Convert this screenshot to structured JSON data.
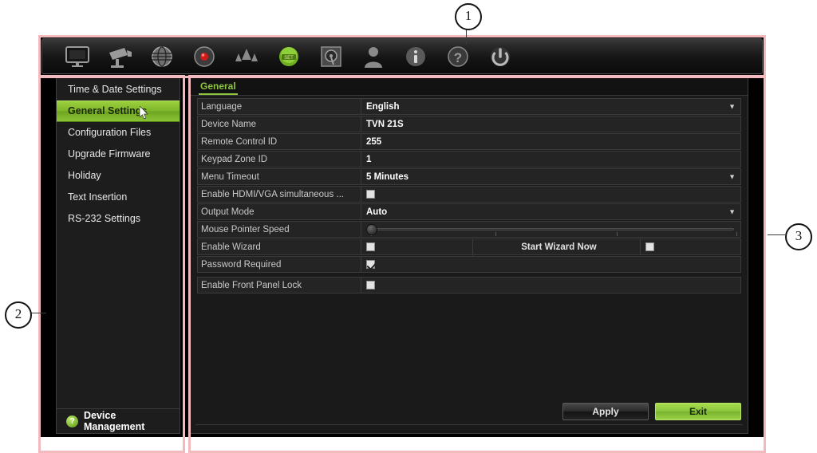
{
  "toolbar": {
    "items": [
      {
        "name": "display-monitor-icon",
        "label": "Display"
      },
      {
        "name": "camera-icon",
        "label": "Camera"
      },
      {
        "name": "network-globe-icon",
        "label": "Network"
      },
      {
        "name": "record-icon",
        "label": "Recording"
      },
      {
        "name": "alarm-icon",
        "label": "Alarm"
      },
      {
        "name": "device-settings-icon",
        "label": "Device Settings"
      },
      {
        "name": "hard-disk-icon",
        "label": "Storage"
      },
      {
        "name": "user-icon",
        "label": "User Management"
      },
      {
        "name": "info-icon",
        "label": "System Information"
      },
      {
        "name": "help-icon",
        "label": "Help"
      },
      {
        "name": "power-icon",
        "label": "Shutdown"
      }
    ]
  },
  "sidebar": {
    "items": [
      {
        "label": "Time & Date Settings",
        "selected": false
      },
      {
        "label": "General Settings",
        "selected": true
      },
      {
        "label": "Configuration Files",
        "selected": false
      },
      {
        "label": "Upgrade Firmware",
        "selected": false
      },
      {
        "label": "Holiday",
        "selected": false
      },
      {
        "label": "Text Insertion",
        "selected": false
      },
      {
        "label": "RS-232 Settings",
        "selected": false
      }
    ],
    "footer": {
      "icon_glyph": "?",
      "label": "Device Management"
    }
  },
  "content": {
    "tab": "General",
    "rows": {
      "language": {
        "label": "Language",
        "value": "English"
      },
      "device_name": {
        "label": "Device Name",
        "value": "TVN 21S"
      },
      "remote_control_id": {
        "label": "Remote Control ID",
        "value": "255"
      },
      "keypad_zone_id": {
        "label": "Keypad Zone ID",
        "value": "1"
      },
      "menu_timeout": {
        "label": "Menu Timeout",
        "value": "5 Minutes"
      },
      "hdmi_vga": {
        "label": "Enable HDMI/VGA simultaneous ...",
        "checked": false
      },
      "output_mode": {
        "label": "Output Mode",
        "value": "Auto"
      },
      "mouse_speed": {
        "label": "Mouse Pointer Speed",
        "value": 0
      },
      "enable_wizard": {
        "label": "Enable Wizard",
        "checked": false,
        "button": "Start Wizard Now",
        "extra_checked": false
      },
      "password_required": {
        "label": "Password Required",
        "checked": true
      },
      "front_panel_lock": {
        "label": "Enable Front Panel Lock",
        "checked": false
      }
    },
    "buttons": {
      "apply": "Apply",
      "exit": "Exit"
    }
  },
  "annotations": {
    "markers": [
      {
        "id": "1",
        "text": "1"
      },
      {
        "id": "2",
        "text": "2"
      },
      {
        "id": "3",
        "text": "3"
      }
    ]
  },
  "colors": {
    "accent_green": "#8dc63f",
    "annotation_border": "#f2b9bf",
    "panel_bg": "#1a1a1a"
  }
}
